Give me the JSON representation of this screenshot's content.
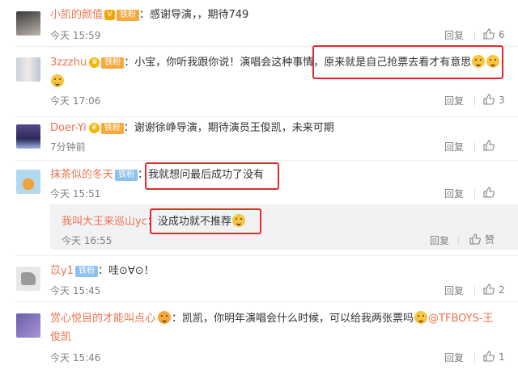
{
  "colors": {
    "username": "#eb7350",
    "highlight_box": "#e02b2b",
    "fan_badge_orange": "#f9a83e",
    "fan_badge_blue": "#8ec0f0"
  },
  "comments": [
    {
      "username": "小凯的颜值",
      "text": "：感谢导演，，期待749",
      "time": "今天 15:59",
      "reply": "回复",
      "likes": "6",
      "fan_badge": "铁粉"
    },
    {
      "username": "3zzzhu",
      "text_a": "：小宝，你听我跟你说！演唱会这种事情，",
      "text_highlight": "原来就是自己抢票去看才有意思",
      "time": "今天 17:06",
      "reply": "回复",
      "likes": "3",
      "fan_badge": "铁粉"
    },
    {
      "username": "Doer-Yi",
      "text": "：谢谢徐峥导演，期待演员王俊凯，未来可期",
      "time": "7分钟前",
      "reply": "回复",
      "likes": "",
      "fan_badge": "铁粉"
    },
    {
      "username": "抹茶似的冬天",
      "text": "我就想问最后成功了没有",
      "colon": "：",
      "time": "今天 15:51",
      "reply": "回复",
      "likes": "",
      "fan_badge": "铁粉",
      "sub_reply": {
        "username": "我叫大王来巡山yc",
        "colon": "：",
        "text": "没成功就不推荐",
        "time": "今天 16:55",
        "reply": "回复",
        "likes": "赞"
      }
    },
    {
      "username": "苡y1",
      "text": "：哇⊙∀⊙！",
      "time": "今天 15:45",
      "reply": "回复",
      "likes": "2",
      "fan_badge": "铁粉"
    },
    {
      "username": "赏心悦目的才能叫点心",
      "text_a": "：凯凯，你明年演唱会什么时候，可以给我两张票吗",
      "mention": "@TFBOYS-王",
      "text_b": "俊凯",
      "time": "今天 15:46",
      "reply": "回复",
      "likes": "1"
    }
  ]
}
